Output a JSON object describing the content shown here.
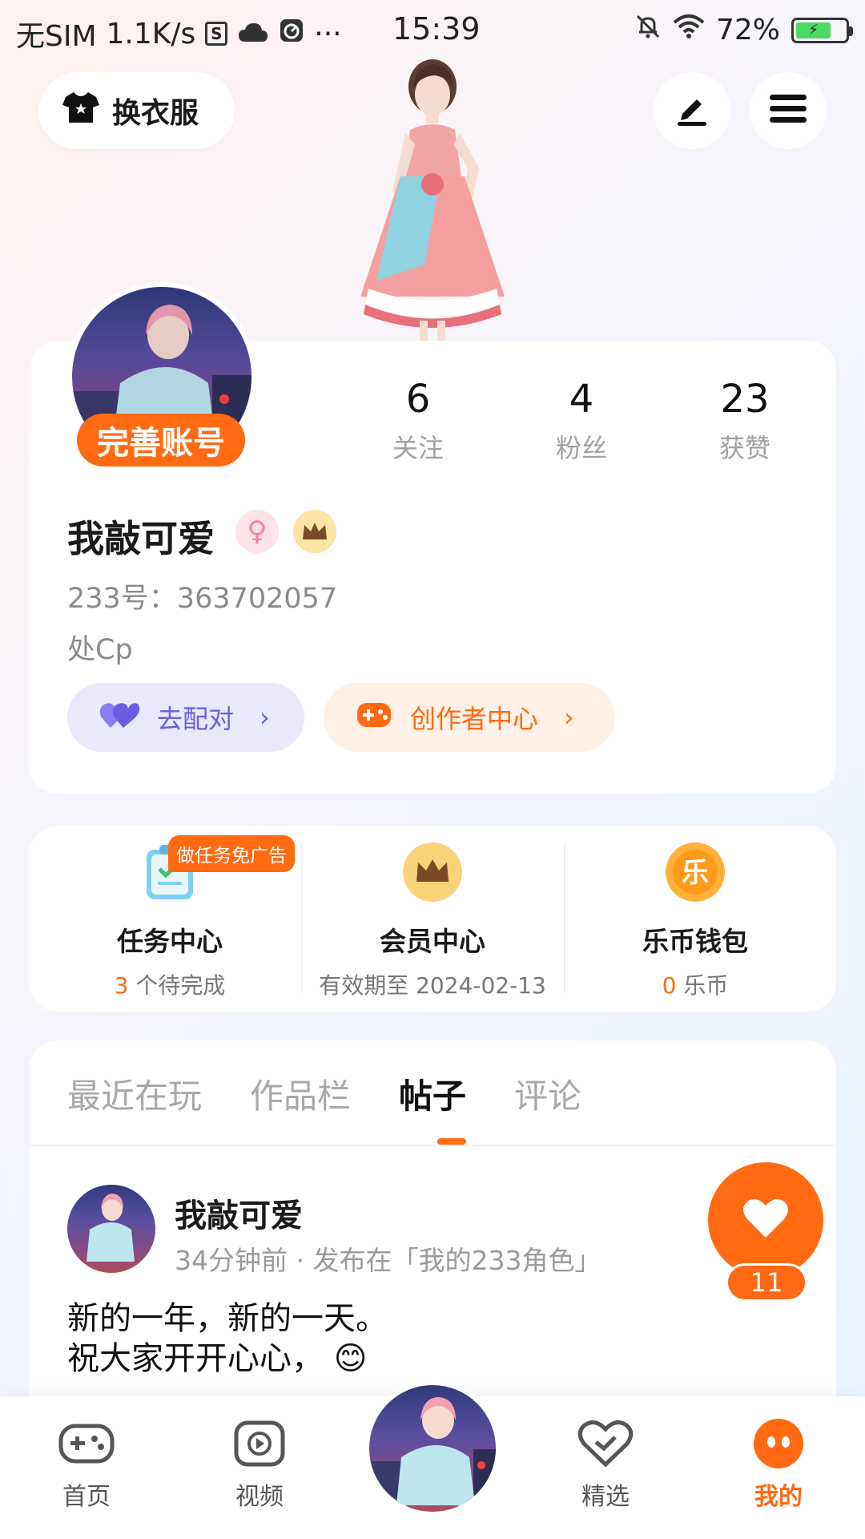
{
  "status_bar": {
    "carrier": "无SIM",
    "speed": "1.1K/s",
    "box_glyph": "S",
    "more": "···",
    "time": "15:39",
    "battery": "72%"
  },
  "header": {
    "outfit_label": "换衣服",
    "edit_icon": "pen-icon",
    "menu_icon": "hamburger-icon"
  },
  "profile": {
    "complete_label": "完善账号",
    "stats": [
      {
        "num": "6",
        "label": "关注"
      },
      {
        "num": "4",
        "label": "粉丝"
      },
      {
        "num": "23",
        "label": "获赞"
      }
    ],
    "nickname": "我敲可爱",
    "gender_symbol": "♀",
    "uid": "233号：363702057",
    "bio": "处Cp",
    "pair_label": "去配对",
    "creator_label": "创作者中心",
    "chevron": "›"
  },
  "services": {
    "task_tag": "做任务免广告",
    "task": {
      "title": "任务中心",
      "count": "3",
      "suffix": " 个待完成"
    },
    "vip": {
      "title": "会员中心",
      "sub": "有效期至 2024-02-13"
    },
    "wallet": {
      "title": "乐币钱包",
      "count": "0",
      "suffix": " 乐币",
      "coin_glyph": "乐"
    }
  },
  "feed": {
    "tabs": [
      "最近在玩",
      "作品栏",
      "帖子",
      "评论"
    ],
    "active_tab": 2,
    "post": {
      "author": "我敲可爱",
      "meta": "34分钟前 · 发布在「我的233角色」",
      "line1": "新的一年，新的一天。",
      "line2": "祝大家开开心心，",
      "emoji": "😊",
      "likes": "11"
    }
  },
  "bottom_nav": {
    "items": [
      {
        "label": "首页",
        "icon": "gamepad-icon"
      },
      {
        "label": "视频",
        "icon": "play-icon"
      },
      {
        "label": "精选",
        "icon": "heart-check-icon"
      },
      {
        "label": "我的",
        "icon": "face-icon"
      }
    ],
    "active_index": 3
  },
  "colors": {
    "accent": "#ff6a13",
    "purple": "#6a5de0",
    "pink": "#ff7aa0",
    "gold": "#f2b949"
  }
}
